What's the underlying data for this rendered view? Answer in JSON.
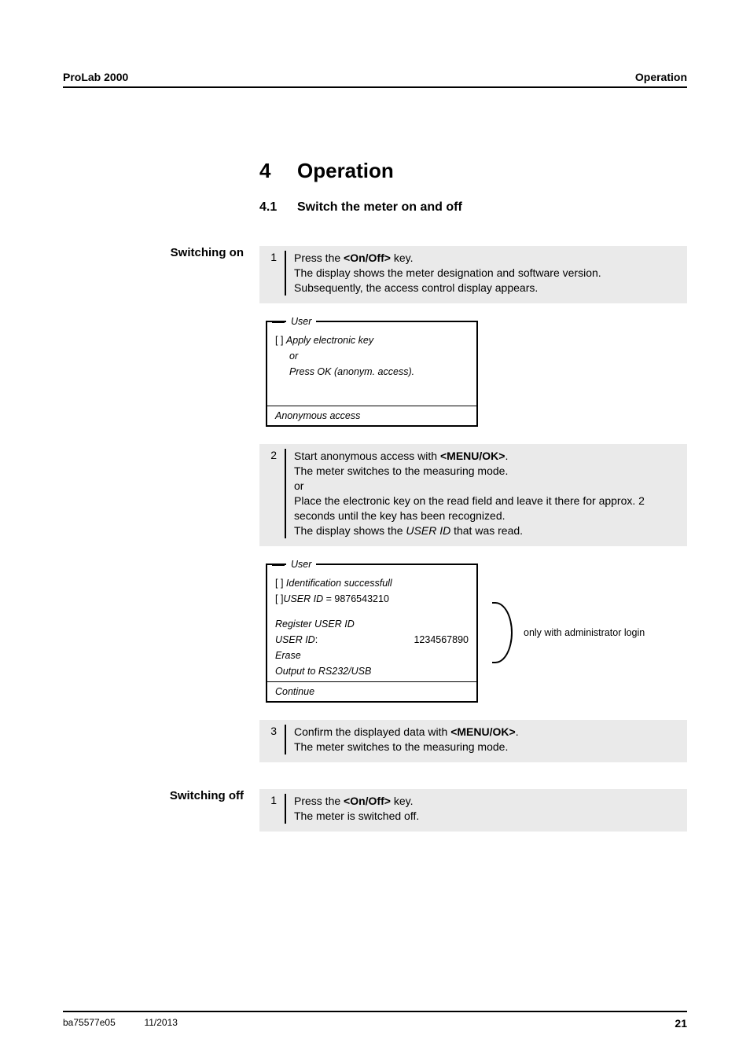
{
  "header": {
    "left": "ProLab 2000",
    "right": "Operation"
  },
  "chapter": {
    "num": "4",
    "title": "Operation"
  },
  "section": {
    "num": "4.1",
    "title": "Switch the meter on and off"
  },
  "switch_on": {
    "label": "Switching on",
    "step1": {
      "num": "1",
      "l1a": "Press the ",
      "l1b": "<On/Off>",
      "l1c": " key.",
      "l2": "The display shows the meter designation and software version.",
      "l3": "Subsequently, the access control display appears."
    },
    "panel1": {
      "title": "User",
      "r1a": "[ ] ",
      "r1b": "Apply electronic key",
      "r2": "or",
      "r3": "Press OK (anonym. access).",
      "footer": "Anonymous access"
    },
    "step2": {
      "num": "2",
      "l1a": "Start anonymous access with ",
      "l1b": "<MENU/OK>",
      "l1c": ".",
      "l2": "The meter switches to the measuring mode.",
      "l3": "or",
      "l4": "Place the electronic key on the read field and leave it there for approx. 2 seconds until the key has been recognized.",
      "l5a": "The display shows the ",
      "l5b": "USER ID",
      "l5c": " that was read."
    },
    "panel2": {
      "title": "User",
      "r1a": "[ ] ",
      "r1b": "Identification successfull",
      "r2a": "[ ]",
      "r2b": "USER ID",
      "r2c": " = 9876543210",
      "r3": "Register USER ID",
      "r4a": "USER ID",
      "r4b": ":",
      "r4c": "1234567890",
      "r5": "Erase",
      "r6": "Output to RS232/USB",
      "footer": "Continue"
    },
    "annot": "only with administrator login",
    "step3": {
      "num": "3",
      "l1a": "Confirm the displayed data with ",
      "l1b": "<MENU/OK>",
      "l1c": ".",
      "l2": "The meter switches to the measuring mode."
    }
  },
  "switch_off": {
    "label": "Switching off",
    "step1": {
      "num": "1",
      "l1a": "Press the ",
      "l1b": "<On/Off>",
      "l1c": " key.",
      "l2": "The meter is switched off."
    }
  },
  "footer": {
    "left": "ba75577e05",
    "mid": "11/2013",
    "page": "21"
  }
}
